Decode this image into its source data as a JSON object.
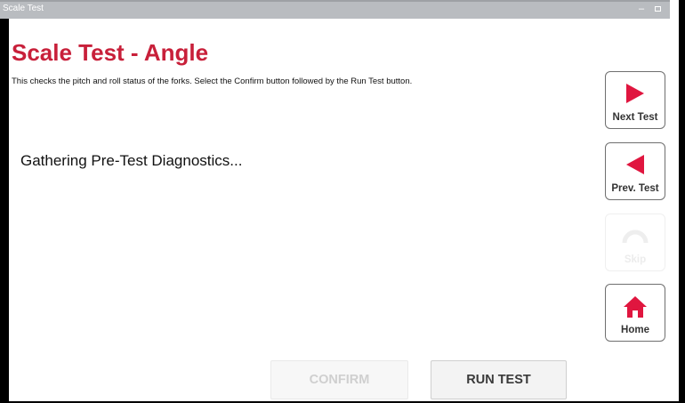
{
  "window": {
    "title": "Scale Test",
    "minimize_glyph": "–"
  },
  "page": {
    "heading": "Scale Test - Angle",
    "description": "This checks the pitch and roll status of the forks. Select the Confirm button followed by the Run Test button.",
    "status": "Gathering Pre-Test Diagnostics..."
  },
  "nav": {
    "next": {
      "label": "Next Test",
      "icon": "play-right-icon",
      "enabled": true
    },
    "prev": {
      "label": "Prev. Test",
      "icon": "play-left-icon",
      "enabled": true
    },
    "skip": {
      "label": "Skip",
      "icon": "skip-icon",
      "enabled": false
    },
    "home": {
      "label": "Home",
      "icon": "home-icon",
      "enabled": true
    }
  },
  "actions": {
    "confirm": {
      "label": "CONFIRM",
      "enabled": false
    },
    "run_test": {
      "label": "RUN TEST",
      "enabled": true
    }
  },
  "colors": {
    "accent": "#c8203a",
    "text": "#111111",
    "disabled": "#cfcfcf"
  }
}
